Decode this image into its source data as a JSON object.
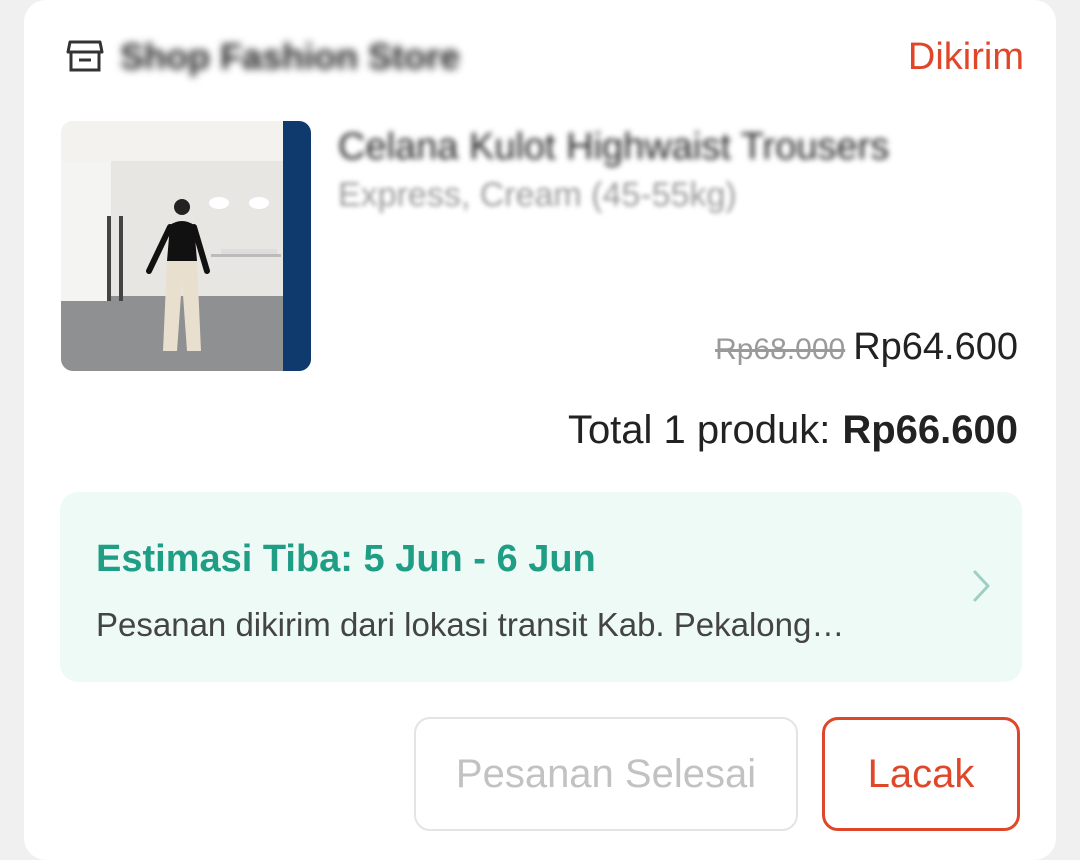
{
  "order": {
    "shop_name": "Shop Fashion Store",
    "status": "Dikirim",
    "product_name": "Celana Kulot Highwaist Trousers",
    "variant": "Express, Cream (45-55kg)",
    "old_price": "Rp68.000",
    "price": "Rp64.600",
    "total_label": "Total 1 produk:",
    "total_amount": "Rp66.600"
  },
  "tracking": {
    "eta": "Estimasi Tiba: 5 Jun - 6 Jun",
    "description": "Pesanan dikirim dari lokasi transit Kab. Pekalong…"
  },
  "actions": {
    "complete_label": "Pesanan Selesai",
    "track_label": "Lacak"
  },
  "colors": {
    "accent": "#e0472a",
    "eta_green": "#1f9e85",
    "tracking_bg": "#eefaf6"
  },
  "icons": {
    "store": "store-icon",
    "chevron": "chevron-right-icon"
  }
}
